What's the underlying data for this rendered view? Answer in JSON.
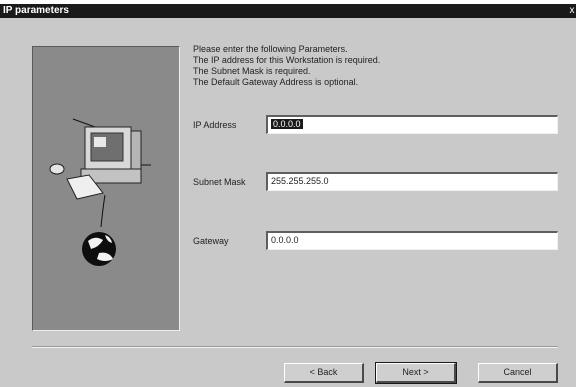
{
  "window": {
    "title": "IP parameters"
  },
  "instructions": [
    "Please enter the following Parameters.",
    "The IP address for this Workstation is required.",
    "The Subnet Mask is required.",
    "The Default Gateway Address is optional."
  ],
  "fields": {
    "ip_address": {
      "label": "IP Address",
      "value": "0.0.0.0"
    },
    "subnet_mask": {
      "label": "Subnet Mask",
      "value": "255.255.255.0"
    },
    "gateway": {
      "label": "Gateway",
      "value": "0.0.0.0"
    }
  },
  "buttons": {
    "back": "< Back",
    "next": "Next >",
    "cancel": "Cancel"
  }
}
